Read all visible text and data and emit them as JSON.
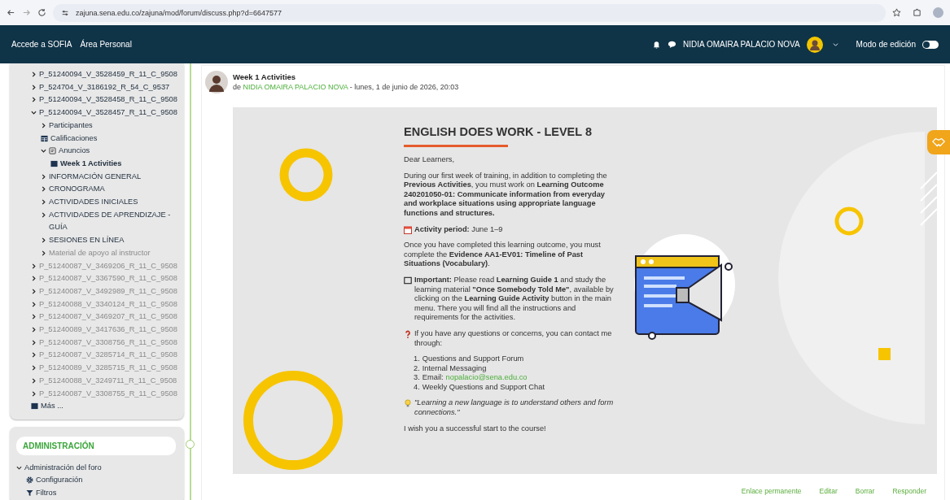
{
  "browser": {
    "url": "zajuna.sena.edu.co/zajuna/mod/forum/discuss.php?d=6647577"
  },
  "navbar": {
    "links": [
      "Accede a SOFIA",
      "Área Personal"
    ],
    "user_name": "NIDIA OMAIRA PALACIO NOVA",
    "edit_mode": {
      "label": "Modo de edición",
      "on": false
    }
  },
  "course_tree": [
    {
      "label": "P_51240094_V_3528459_R_11_C_9508",
      "kind": "course",
      "expanded": false,
      "dimmed": false,
      "selected": false
    },
    {
      "label": "P_524704_V_3186192_R_54_C_9537",
      "kind": "course",
      "expanded": false,
      "dimmed": false,
      "selected": false
    },
    {
      "label": "P_51240094_V_3528458_R_11_C_9508",
      "kind": "course",
      "expanded": false,
      "dimmed": false,
      "selected": false
    },
    {
      "label": "P_51240094_V_3528457_R_11_C_9508",
      "kind": "course",
      "expanded": true,
      "dimmed": false,
      "selected": false,
      "children": [
        {
          "label": "Participantes",
          "kind": "section",
          "expanded": false,
          "dimmed": false,
          "selected": false
        },
        {
          "label": "Calificaciones",
          "kind": "grades",
          "dimmed": false,
          "selected": false
        },
        {
          "label": "Anuncios",
          "kind": "forum",
          "expanded": true,
          "dimmed": false,
          "selected": false,
          "children": [
            {
              "label": "Week 1 Activities",
              "kind": "post",
              "dimmed": false,
              "selected": true
            }
          ]
        },
        {
          "label": "INFORMACIÓN GENERAL",
          "kind": "section",
          "expanded": false,
          "dimmed": false,
          "selected": false
        },
        {
          "label": "CRONOGRAMA",
          "kind": "section",
          "expanded": false,
          "dimmed": false,
          "selected": false
        },
        {
          "label": "ACTIVIDADES INICIALES",
          "kind": "section",
          "expanded": false,
          "dimmed": false,
          "selected": false
        },
        {
          "label": "ACTIVIDADES DE APRENDIZAJE - GUÍA",
          "kind": "section",
          "expanded": false,
          "dimmed": false,
          "selected": false
        },
        {
          "label": "SESIONES EN LÍNEA",
          "kind": "section",
          "expanded": false,
          "dimmed": false,
          "selected": false
        },
        {
          "label": "Material de apoyo al instructor",
          "kind": "section",
          "expanded": false,
          "dimmed": true,
          "selected": false
        }
      ]
    },
    {
      "label": "P_51240087_V_3469206_R_11_C_9508",
      "kind": "course",
      "expanded": false,
      "dimmed": true,
      "selected": false
    },
    {
      "label": "P_51240087_V_3367590_R_11_C_9508",
      "kind": "course",
      "expanded": false,
      "dimmed": true,
      "selected": false
    },
    {
      "label": "P_51240087_V_3492989_R_11_C_9508",
      "kind": "course",
      "expanded": false,
      "dimmed": true,
      "selected": false
    },
    {
      "label": "P_51240088_V_3340124_R_11_C_9508",
      "kind": "course",
      "expanded": false,
      "dimmed": true,
      "selected": false
    },
    {
      "label": "P_51240087_V_3469207_R_11_C_9508",
      "kind": "course",
      "expanded": false,
      "dimmed": true,
      "selected": false
    },
    {
      "label": "P_51240089_V_3417636_R_11_C_9508",
      "kind": "course",
      "expanded": false,
      "dimmed": true,
      "selected": false
    },
    {
      "label": "P_51240087_V_3308756_R_11_C_9508",
      "kind": "course",
      "expanded": false,
      "dimmed": true,
      "selected": false
    },
    {
      "label": "P_51240087_V_3285714_R_11_C_9508",
      "kind": "course",
      "expanded": false,
      "dimmed": true,
      "selected": false
    },
    {
      "label": "P_51240089_V_3285715_R_11_C_9508",
      "kind": "course",
      "expanded": false,
      "dimmed": true,
      "selected": false
    },
    {
      "label": "P_51240088_V_3249711_R_11_C_9508",
      "kind": "course",
      "expanded": false,
      "dimmed": true,
      "selected": false
    },
    {
      "label": "P_51240087_V_3308755_R_11_C_9508",
      "kind": "course",
      "expanded": false,
      "dimmed": true,
      "selected": false
    },
    {
      "label": "Más ...",
      "kind": "more",
      "dimmed": false,
      "selected": false
    }
  ],
  "administration": {
    "title": "ADMINISTRACIÓN",
    "items": [
      {
        "label": "Administración del foro",
        "kind": "group",
        "expanded": true,
        "children": [
          {
            "label": "Configuración",
            "kind": "settings"
          },
          {
            "label": "Filtros",
            "kind": "filter"
          }
        ]
      }
    ]
  },
  "post": {
    "title": "Week 1 Activities",
    "by": "de",
    "author": "NIDIA OMAIRA PALACIO NOVA",
    "date": " - lunes, 1 de junio de 2026, 20:03",
    "content": {
      "heading": "ENGLISH DOES WORK - LEVEL 8",
      "blocks": [
        {
          "kind": "text",
          "text": "Dear Learners,"
        },
        {
          "kind": "text",
          "text": "During our first week of training, in addition to completing the **Previous Activities**, you must work on **Learning Outcome 240201050-01: Communicate information from everyday and workplace situations using appropriate language functions and structures.**"
        },
        {
          "kind": "period",
          "text": "**Activity period:** June 1–9"
        },
        {
          "kind": "text",
          "text": "Once you have completed this learning outcome, you must complete the **Evidence AA1-EV01: Timeline of Past Situations (Vocabulary)**."
        },
        {
          "kind": "important",
          "text": "**Important:** Please read **Learning Guide 1** and study the learning material **\"Once Somebody Told Me\"**, available by clicking on the **Learning Guide Activity** button in the main menu. There you will find all the instructions and requirements for the activities."
        },
        {
          "kind": "question",
          "text": "If you have any questions or concerns, you can contact me through:"
        },
        {
          "kind": "list",
          "items": [
            {
              "number": "1.",
              "text": "Questions and Support Forum"
            },
            {
              "number": "2.",
              "text": "Internal Messaging"
            },
            {
              "number": "3.",
              "text": "Email:",
              "link": "nopalacio@sena.edu.co"
            },
            {
              "number": "4.",
              "text": "Weekly Questions and Support Chat"
            }
          ]
        },
        {
          "kind": "quote",
          "text": "\"Learning a new language is to understand others and form connections.\""
        },
        {
          "kind": "text",
          "text": "I wish you a successful start to the course!"
        }
      ]
    },
    "actions": [
      "Enlace permanente",
      "Editar",
      "Borrar",
      "Responder"
    ]
  }
}
